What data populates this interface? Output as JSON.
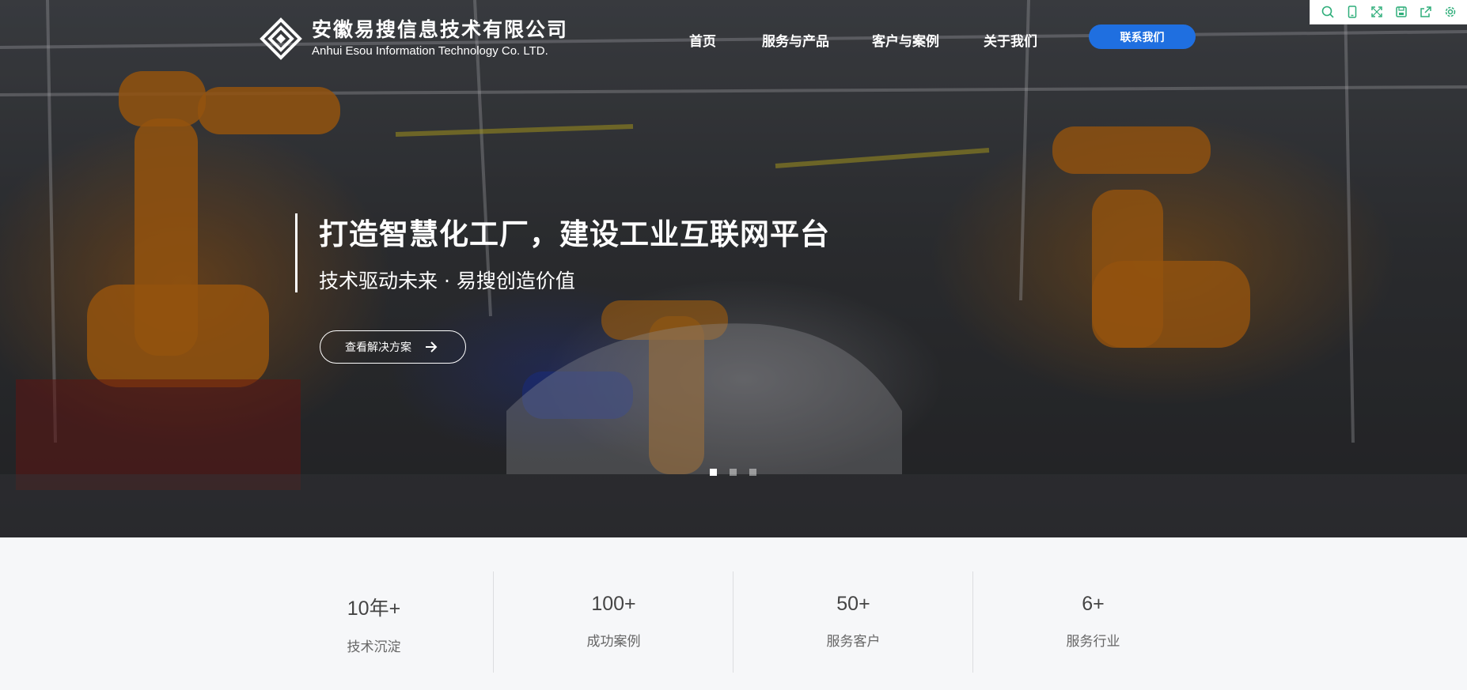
{
  "brand": {
    "name_cn": "安徽易搜信息技术有限公司",
    "name_en": "Anhui Esou Information Technology Co. LTD."
  },
  "nav": {
    "items": [
      {
        "label": "首页"
      },
      {
        "label": "服务与产品"
      },
      {
        "label": "客户与案例"
      },
      {
        "label": "关于我们"
      }
    ],
    "contact_label": "联系我们"
  },
  "toolbar": {
    "icons": [
      "search-icon",
      "mobile-icon",
      "fullscreen-icon",
      "save-icon",
      "share-icon",
      "settings-icon"
    ]
  },
  "hero": {
    "title": "打造智慧化工厂，建设工业互联网平台",
    "subtitle": "技术驱动未来 · 易搜创造价值",
    "cta_label": "查看解决方案",
    "slides_count": 3,
    "active_slide": 1
  },
  "stats": [
    {
      "value": "10年+",
      "label": "技术沉淀"
    },
    {
      "value": "100+",
      "label": "成功案例"
    },
    {
      "value": "50+",
      "label": "服务客户"
    },
    {
      "value": "6+",
      "label": "服务行业"
    }
  ],
  "colors": {
    "accent": "#1f6fe0",
    "toolbar_icon": "#2fae7a",
    "stats_bg": "#f6f7f9"
  }
}
